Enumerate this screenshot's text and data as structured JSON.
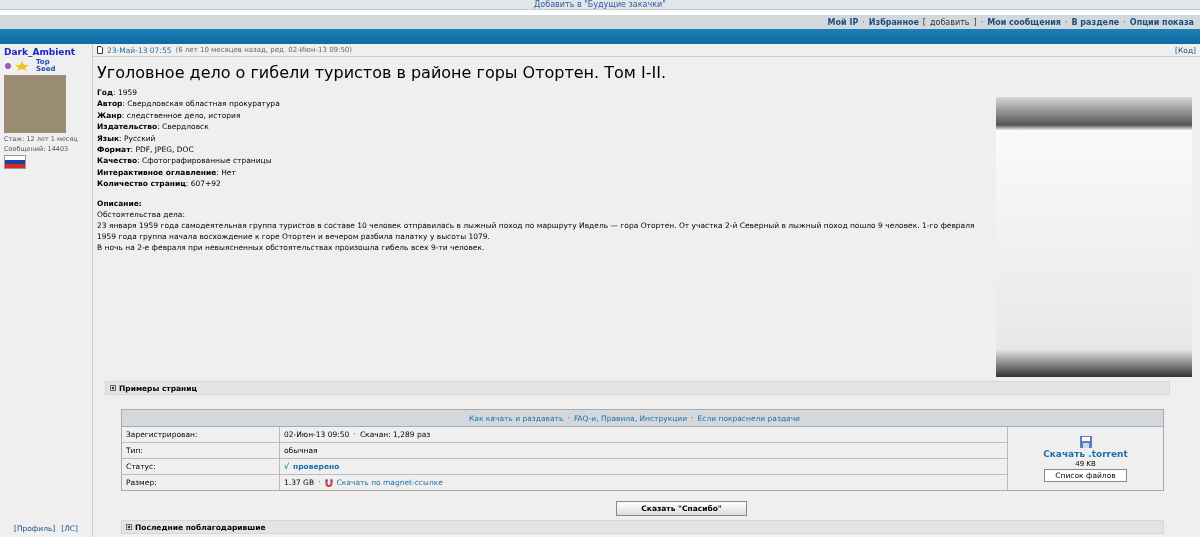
{
  "top_link": "Добавить в \"Будущие закачки\"",
  "nav_separator": "·",
  "nav": [
    {
      "kind": "link",
      "text": "Мой IP"
    },
    {
      "kind": "link",
      "text": "Избранное",
      "open": "[",
      "extra": "добавить",
      "close": "]"
    },
    {
      "kind": "link",
      "text": "Мои сообщения"
    },
    {
      "kind": "link",
      "text": "В разделе"
    },
    {
      "kind": "link",
      "text": "Опции показа"
    }
  ],
  "user": {
    "name": "Dark_Ambient",
    "badge": "Top Seed",
    "experience": "Стаж: 12 лет 1 месяц",
    "posts": "Сообщений: 14403",
    "links": [
      "[Профиль]",
      "[ЛС]"
    ]
  },
  "post": {
    "date": "23-Май-13 07:55",
    "meta": "(6 лет 10 месяцев назад, ред. 02-Июн-13 09:50)",
    "code_link": "[Код]",
    "title": "Уголовное дело о гибели туристов в районе горы Отортен. Том I-II.",
    "fields": [
      "**Год**: 1959",
      "**Автор**: Свердловская областная прокуратура",
      "**Жанр**: следственное дело, история",
      "**Издательство**: Свердловск",
      "**Язык**: Русский",
      "**Формат**: PDF, JPEG, DOC",
      "**Качество**: Сфотографированные страницы",
      "**Интерактивное оглавление**: Нет",
      "**Количество страниц**: 607+92"
    ],
    "description_label": "Описание:",
    "description": [
      "Обстоятельства дела:",
      "23 января 1959 года самодеятельная группа туристов в составе 10 человек отправилась в лыжный поход по маршруту Ивдель — гора Отортен. От участка 2-й Северный в лыжный поход пошло 9 человек. 1-го февраля 1959 года группа начала восхождение к горе Отортен и вечером разбила палатку у высоты 1079.",
      "В ночь на 2-е февраля при невыясненных обстоятельствах произошла гибель всех 9-ти человек."
    ],
    "spoiler": {
      "title": "Примеры страниц",
      "expanded": false
    }
  },
  "torrent": {
    "separator": "·",
    "help_links": [
      "Как качать и раздавать",
      "FAQ-и, Правила, Инструкции",
      "Если покраснели раздачи"
    ],
    "rows": [
      {
        "label": "Зарегистрирован:",
        "value": "02-Июн-13 09:50",
        "extra": "Скачан: 1,289 раз"
      },
      {
        "label": "Тип:",
        "value": "обычная"
      },
      {
        "label": "Статус:",
        "value": "проверено",
        "kind": "status",
        "icon": "√"
      },
      {
        "label": "Размер:",
        "value": "1.37 GB",
        "link": "Скачать по magnet-ссылке"
      }
    ],
    "download": "Скачать .torrent",
    "size": "49 KB",
    "files_button": "Список файлов"
  },
  "thanks_button": "Сказать \"Спасибо\"",
  "thanked": {
    "title": "Последние поблагодарившие",
    "expanded": false
  }
}
